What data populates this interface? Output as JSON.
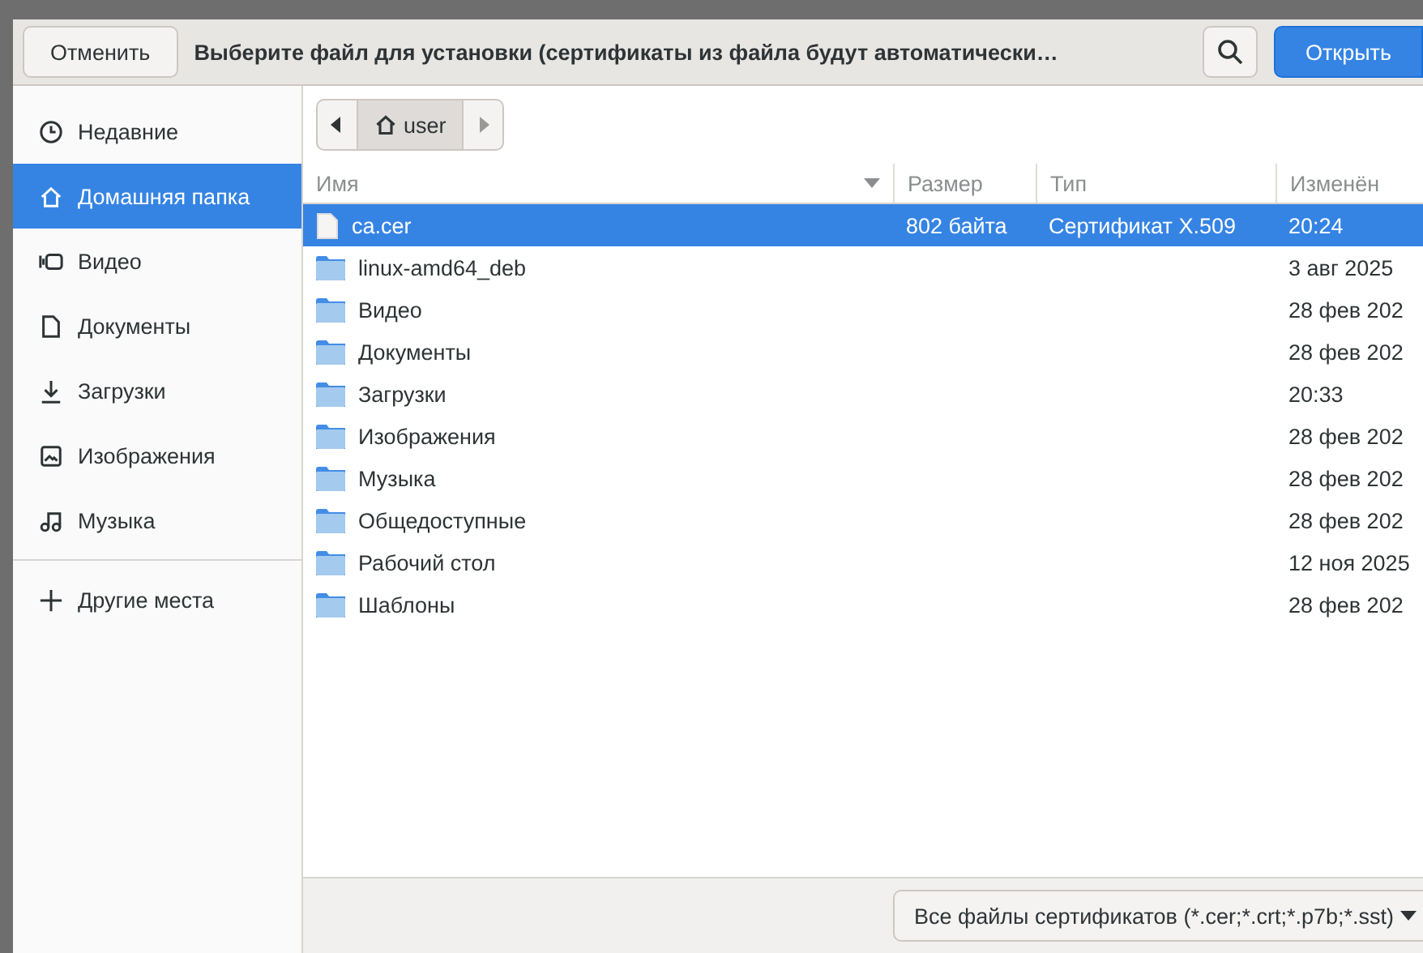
{
  "header": {
    "cancel": "Отменить",
    "title": "Выберите файл для установки (сертификаты из файла будут автоматически…",
    "open": "Открыть"
  },
  "sidebar": {
    "items": [
      {
        "label": "Недавние",
        "selected": false
      },
      {
        "label": "Домашняя папка",
        "selected": true
      },
      {
        "label": "Видео",
        "selected": false
      },
      {
        "label": "Документы",
        "selected": false
      },
      {
        "label": "Загрузки",
        "selected": false
      },
      {
        "label": "Изображения",
        "selected": false
      },
      {
        "label": "Музыка",
        "selected": false
      }
    ],
    "other": {
      "label": "Другие места"
    }
  },
  "path_bar": {
    "segment": "user"
  },
  "table": {
    "columns": [
      "Имя",
      "Размер",
      "Тип",
      "Изменён"
    ],
    "rows": [
      {
        "kind": "file",
        "name": "ca.cer",
        "size": "802 байта",
        "type": "Сертификат X.509",
        "modified": "20:24",
        "selected": true
      },
      {
        "kind": "folder",
        "name": "linux-amd64_deb",
        "modified": "3 авг 2025",
        "selected": false
      },
      {
        "kind": "folder",
        "name": "Видео",
        "modified": "28 фев 202",
        "selected": false
      },
      {
        "kind": "folder",
        "name": "Документы",
        "modified": "28 фев 202",
        "selected": false
      },
      {
        "kind": "folder",
        "name": "Загрузки",
        "modified": "20:33",
        "selected": false
      },
      {
        "kind": "folder",
        "name": "Изображения",
        "modified": "28 фев 202",
        "selected": false
      },
      {
        "kind": "folder",
        "name": "Музыка",
        "modified": "28 фев 202",
        "selected": false
      },
      {
        "kind": "folder",
        "name": "Общедоступные",
        "modified": "28 фев 202",
        "selected": false
      },
      {
        "kind": "folder",
        "name": "Рабочий стол",
        "modified": "12 ноя 2025",
        "selected": false
      },
      {
        "kind": "folder",
        "name": "Шаблоны",
        "modified": "28 фев 202",
        "selected": false
      }
    ]
  },
  "filter": {
    "value": "Все файлы сертификатов (*.cer;*.crt;*.p7b;*.sst)"
  }
}
